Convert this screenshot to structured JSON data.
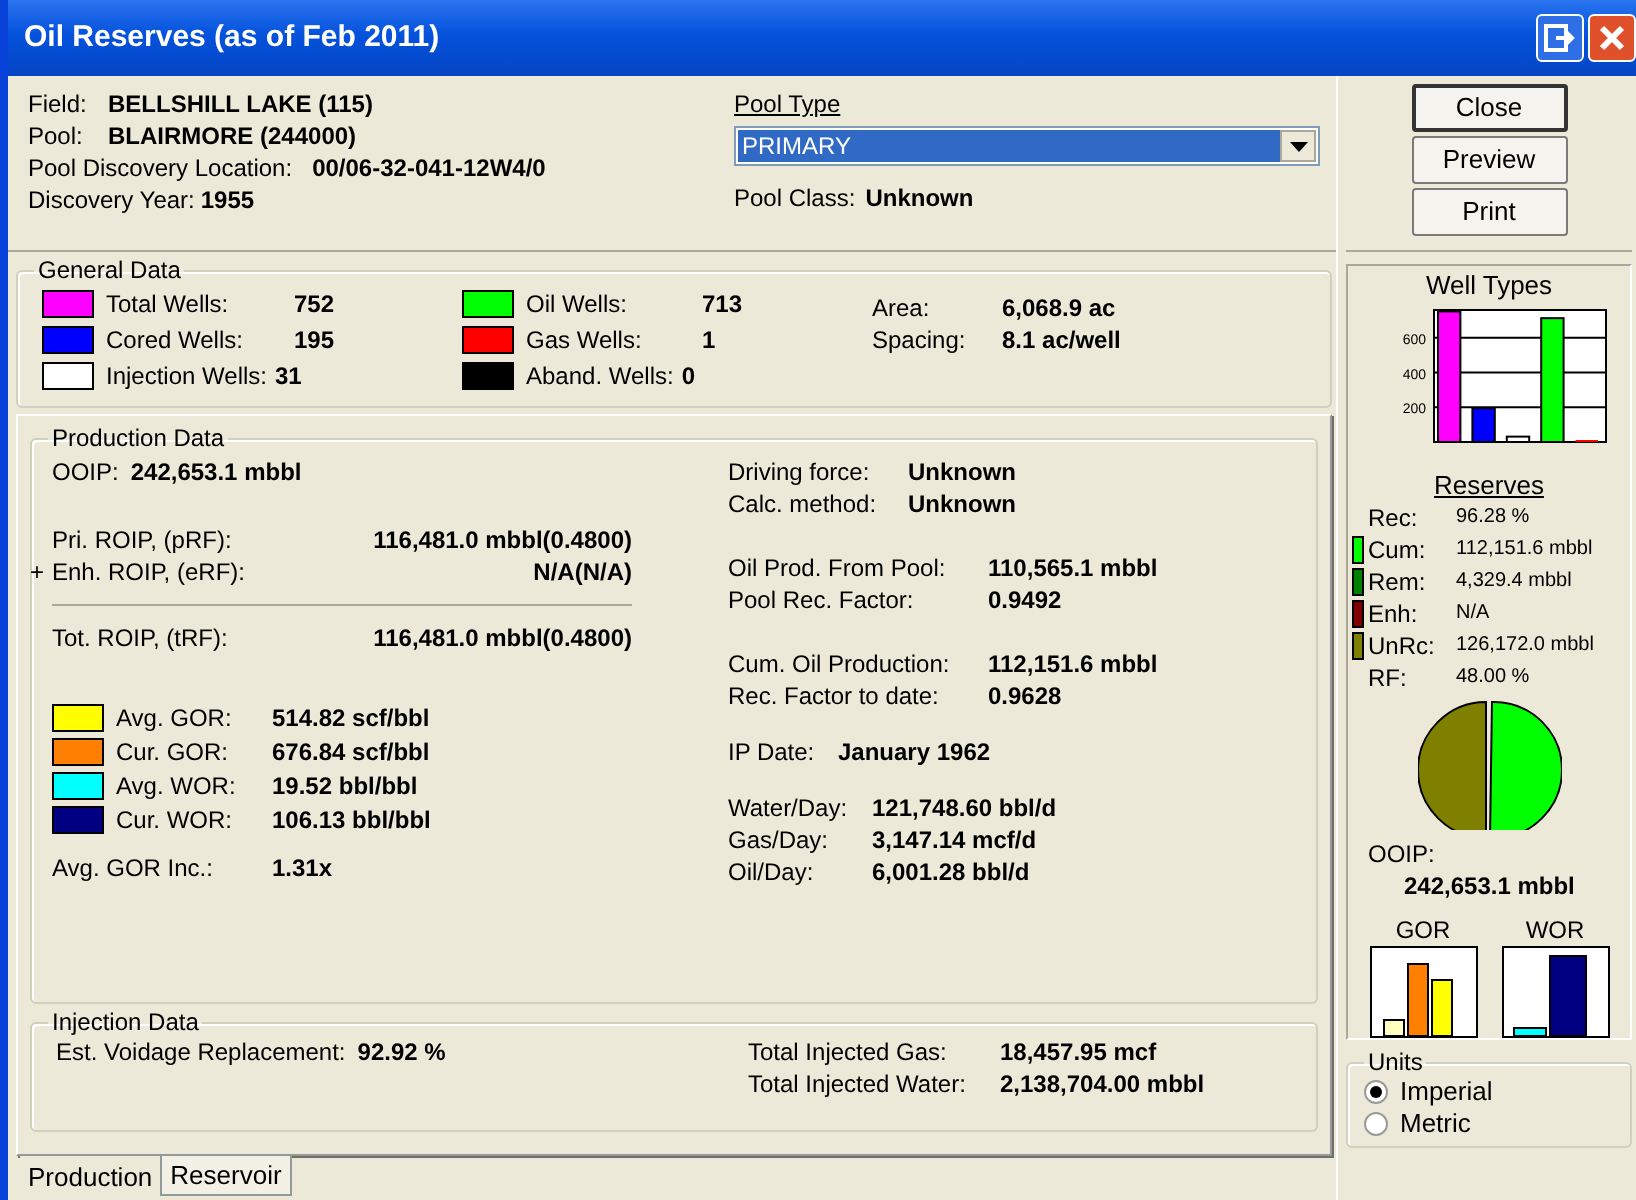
{
  "window": {
    "title": "Oil Reserves (as of Feb 2011)"
  },
  "header": {
    "fields": [
      {
        "label": "Field:",
        "value": "BELLSHILL LAKE (115)"
      },
      {
        "label": "Pool:",
        "value": "BLAIRMORE (244000)"
      },
      {
        "label": "Pool Discovery Location:",
        "value": "00/06-32-041-12W4/0"
      },
      {
        "label": "Discovery Year:",
        "value": "1955"
      }
    ],
    "pool_type": {
      "label": "Pool Type",
      "value": "PRIMARY"
    },
    "pool_class": {
      "label": "Pool Class:",
      "value": "Unknown"
    }
  },
  "buttons": [
    {
      "label": "Close",
      "default": true
    },
    {
      "label": "Preview",
      "default": false
    },
    {
      "label": "Print",
      "default": false
    }
  ],
  "general_data": {
    "title": "General Data",
    "wells": [
      {
        "label": "Total Wells:",
        "value": "752",
        "color": "#ff00ff"
      },
      {
        "label": "Cored Wells:",
        "value": "195",
        "color": "#0000ff"
      },
      {
        "label": "Injection Wells:",
        "value": "31",
        "color": "#ffffff"
      },
      {
        "label": "Oil Wells:",
        "value": "713",
        "color": "#00ff00"
      },
      {
        "label": "Gas Wells:",
        "value": "1",
        "color": "#ff0000"
      },
      {
        "label": "Aband. Wells:",
        "value": "0",
        "color": "#000000"
      }
    ],
    "area": [
      {
        "label": "Area:",
        "value": "6,068.9 ac"
      },
      {
        "label": "Spacing:",
        "value": "8.1 ac/well"
      }
    ]
  },
  "production_data": {
    "title": "Production Data",
    "ooip": {
      "label": "OOIP:",
      "value": "242,653.1 mbbl"
    },
    "roip": [
      {
        "label": "Pri. ROIP, (pRF):",
        "value": "116,481.0 mbbl(0.4800)"
      },
      {
        "prefix": "+",
        "label": "Enh. ROIP, (eRF):",
        "value": "N/A(N/A)"
      }
    ],
    "total_roip": {
      "label": "Tot. ROIP, (tRF):",
      "value": "116,481.0 mbbl(0.4800)"
    },
    "ratios": [
      {
        "label": "Avg. GOR:",
        "value": "514.82 scf/bbl",
        "color": "#ffff00"
      },
      {
        "label": "Cur. GOR:",
        "value": "676.84 scf/bbl",
        "color": "#ff8000"
      },
      {
        "label": "Avg. WOR:",
        "value": "19.52 bbl/bbl",
        "color": "#00ffff"
      },
      {
        "label": "Cur. WOR:",
        "value": "106.13 bbl/bbl",
        "color": "#000080"
      }
    ],
    "gor_inc": {
      "label": "Avg. GOR Inc.:",
      "value": "1.31x"
    },
    "groups": [
      {
        "rows": [
          {
            "label": "Driving force:",
            "value": "Unknown"
          },
          {
            "label": "Calc. method:",
            "value": "Unknown"
          }
        ]
      },
      {
        "rows": [
          {
            "label": "Oil Prod. From Pool:",
            "value": "110,565.1 mbbl"
          },
          {
            "label": "Pool Rec. Factor:",
            "value": "0.9492"
          }
        ]
      },
      {
        "rows": [
          {
            "label": "Cum. Oil Production:",
            "value": "112,151.6 mbbl"
          },
          {
            "label": "Rec. Factor to date:",
            "value": "0.9628"
          }
        ]
      },
      {
        "rows": [
          {
            "label": "IP Date:",
            "value": "January 1962"
          }
        ]
      },
      {
        "rows": [
          {
            "label": "Water/Day:",
            "value": "121,748.60 bbl/d"
          },
          {
            "label": "Gas/Day:",
            "value": "3,147.14 mcf/d"
          },
          {
            "label": "Oil/Day:",
            "value": "6,001.28 bbl/d"
          }
        ]
      }
    ]
  },
  "injection_data": {
    "title": "Injection Data",
    "voidage": {
      "label": "Est. Voidage Replacement:",
      "value": "92.92 %"
    },
    "totals": [
      {
        "label": "Total Injected Gas:",
        "value": "18,457.95 mcf"
      },
      {
        "label": "Total Injected Water:",
        "value": "2,138,704.00 mbbl"
      }
    ]
  },
  "tabs": [
    {
      "label": "Production",
      "selected": true
    },
    {
      "label": "Reservoir",
      "selected": false
    }
  ],
  "well_types": {
    "chart_data": {
      "type": "bar",
      "title": "Well Types",
      "values": [
        752,
        195,
        31,
        713,
        1
      ],
      "ylim": [
        0,
        760
      ],
      "yticks": [
        200,
        400,
        600
      ],
      "grid": true
    }
  },
  "reserves": {
    "title": "Reserves",
    "rows": [
      {
        "label": "Rec:",
        "value": "96.28 %"
      },
      {
        "label": "Cum:",
        "value": "112,151.6 mbbl",
        "color": "#00ff00"
      },
      {
        "label": "Rem:",
        "value": "4,329.4 mbbl",
        "color": "#008000"
      },
      {
        "label": "Enh:",
        "value": "N/A",
        "color": "#800000"
      },
      {
        "label": "UnRc:",
        "value": "126,172.0 mbbl",
        "color": "#808000"
      },
      {
        "label": "RF:",
        "value": "48.00 %"
      }
    ]
  },
  "ooip": {
    "label": "OOIP:",
    "value": "242,653.1 mbbl"
  },
  "ratio_charts": [
    {
      "title": "GOR"
    },
    {
      "title": "WOR"
    }
  ],
  "units": {
    "title": "Units",
    "options": [
      {
        "label": "Imperial",
        "selected": true
      },
      {
        "label": "Metric",
        "selected": false
      }
    ]
  }
}
